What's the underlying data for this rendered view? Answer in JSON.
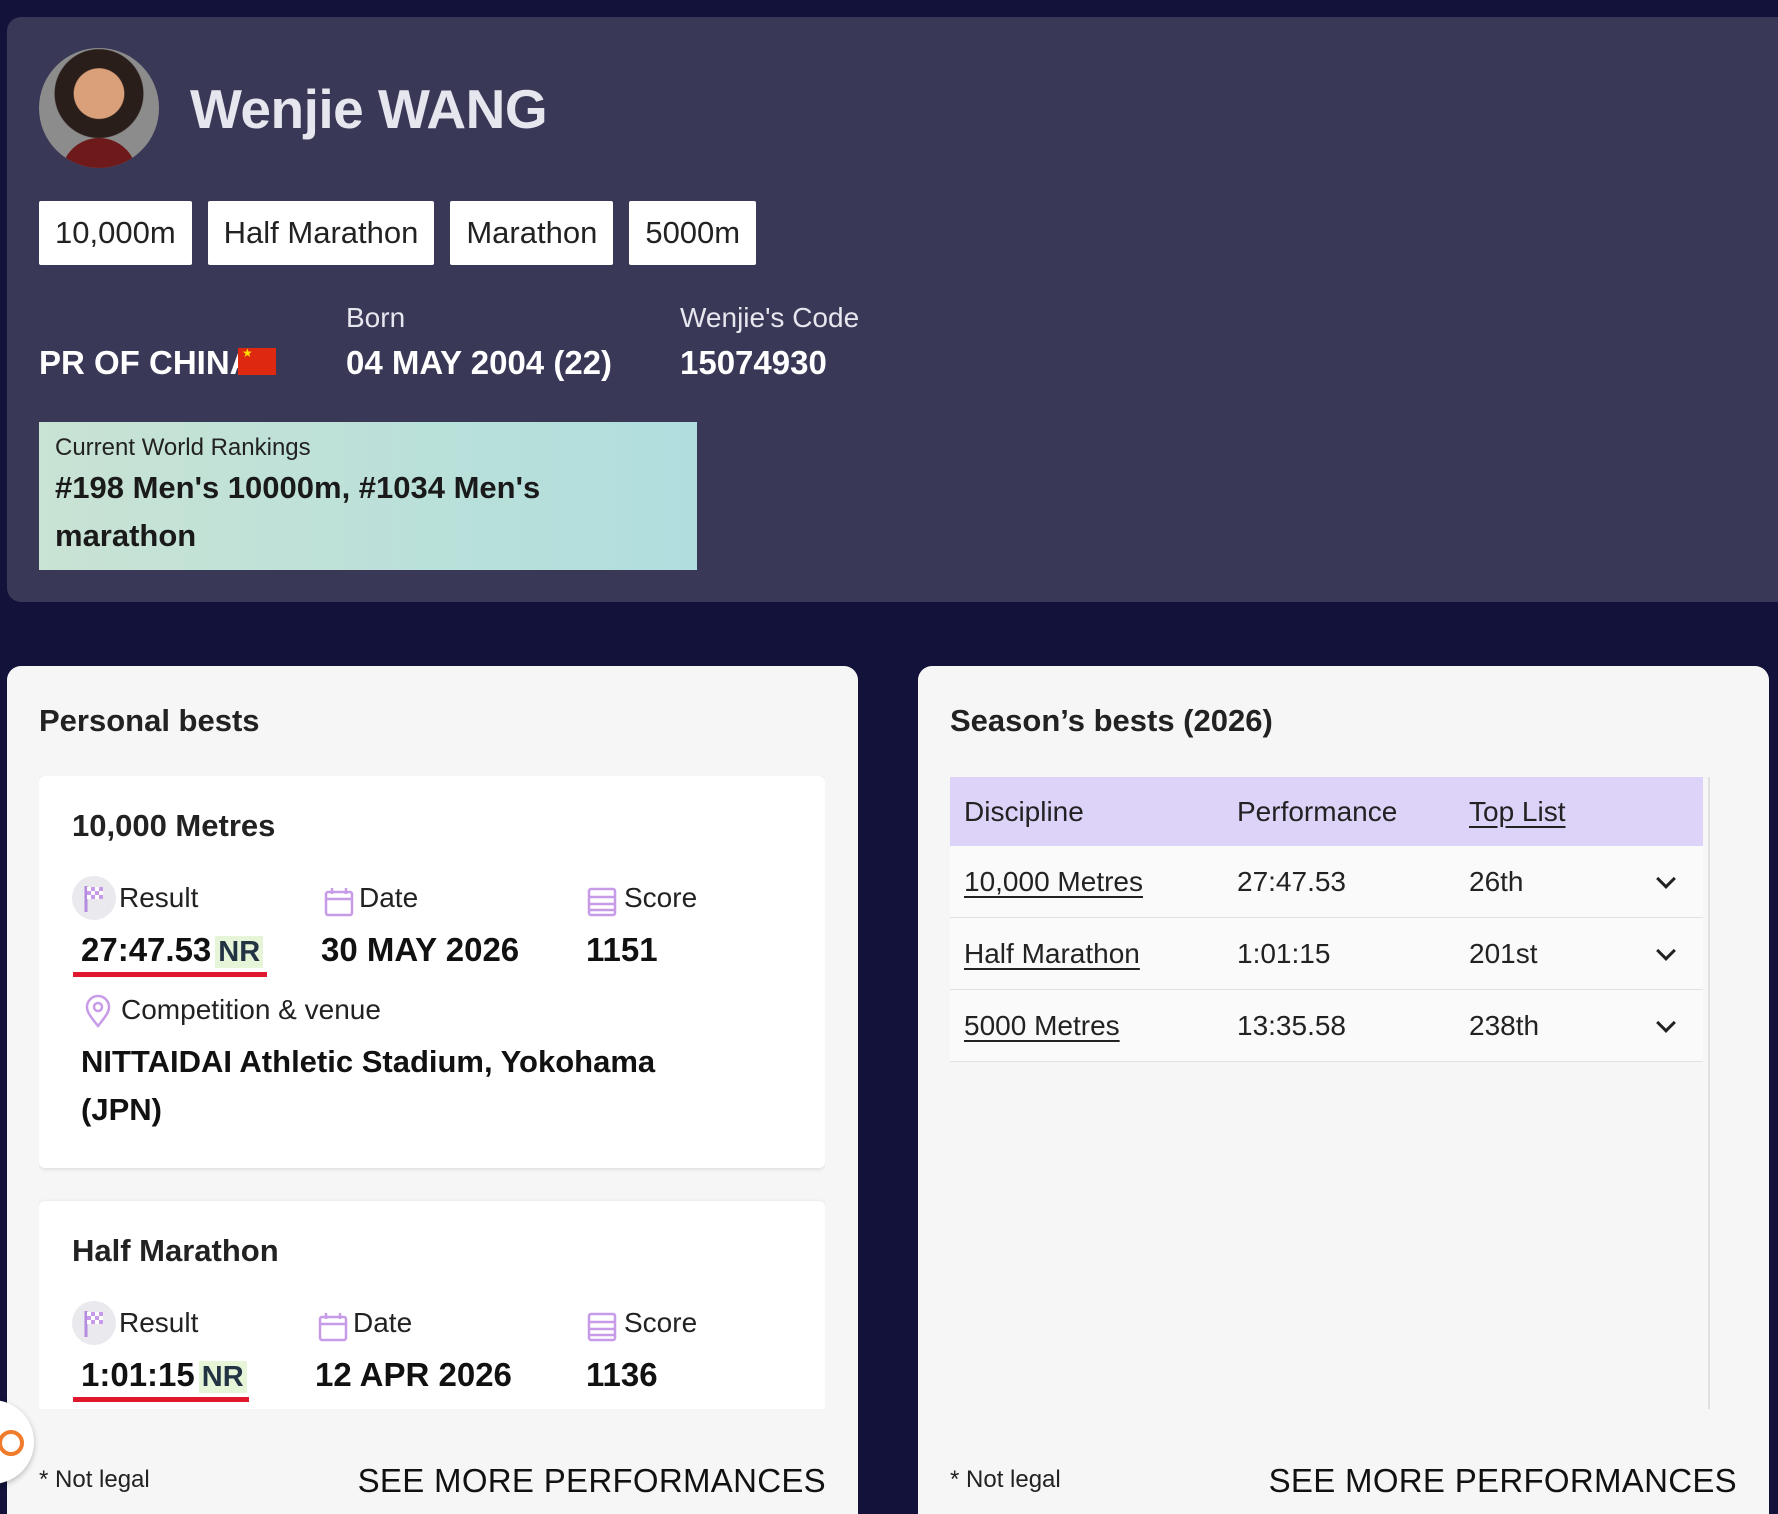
{
  "athlete": {
    "name": "Wenjie WANG",
    "disciplines": [
      "10,000m",
      "Half Marathon",
      "Marathon",
      "5000m"
    ],
    "country": "PR OF CHINA",
    "born_label": "Born",
    "born_value": "04 MAY 2004 (22)",
    "code_label": "Wenjie's Code",
    "code_value": "15074930",
    "rankings_label": "Current World Rankings",
    "rankings_value": "#198 Men's 10000m, #1034 Men's marathon"
  },
  "personal_bests": {
    "title": "Personal bests",
    "labels": {
      "result": "Result",
      "date": "Date",
      "score": "Score",
      "venue": "Competition & venue"
    },
    "cards": [
      {
        "event": "10,000 Metres",
        "result": "27:47.53",
        "badge": "NR",
        "date": "30 MAY 2026",
        "score": "1151",
        "venue": "NITTAIDAI Athletic Stadium, Yokohama (JPN)"
      },
      {
        "event": "Half Marathon",
        "result": "1:01:15",
        "badge": "NR",
        "date": "12 APR 2026",
        "score": "1136"
      }
    ],
    "note": "* Not legal",
    "see_more": "SEE MORE PERFORMANCES"
  },
  "season_bests": {
    "title": "Season’s bests (2026)",
    "columns": {
      "discipline": "Discipline",
      "performance": "Performance",
      "toplist": "Top List"
    },
    "rows": [
      {
        "discipline": "10,000 Metres",
        "performance": "27:47.53",
        "toplist": "26th"
      },
      {
        "discipline": "Half Marathon",
        "performance": "1:01:15",
        "toplist": "201st"
      },
      {
        "discipline": "5000 Metres",
        "performance": "13:35.58",
        "toplist": "238th"
      }
    ],
    "note": "* Not legal",
    "see_more": "SEE MORE PERFORMANCES"
  },
  "colors": {
    "page_bg": "#12123a",
    "header_bg": "#393857",
    "table_head": "#ddd2f8",
    "accent_red": "#e0182d",
    "icon_purple": "#c79be8"
  }
}
